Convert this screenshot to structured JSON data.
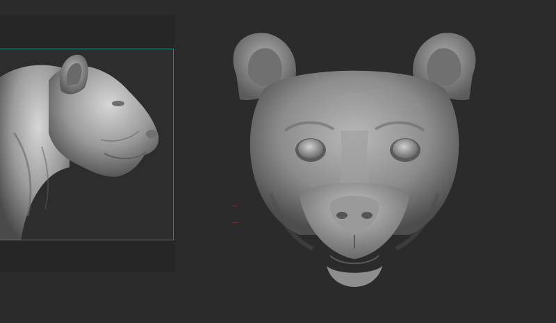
{
  "app": {
    "window_title": "",
    "scene": "sculpting-viewport"
  },
  "viewport": {
    "background_color": "#2b2b2b",
    "reference_panel": {
      "frame_color": "#2e8f86",
      "background_color": "#262626",
      "view": "side-profile"
    },
    "main_model": {
      "view": "front",
      "material_color": "#8a8a8a"
    }
  }
}
